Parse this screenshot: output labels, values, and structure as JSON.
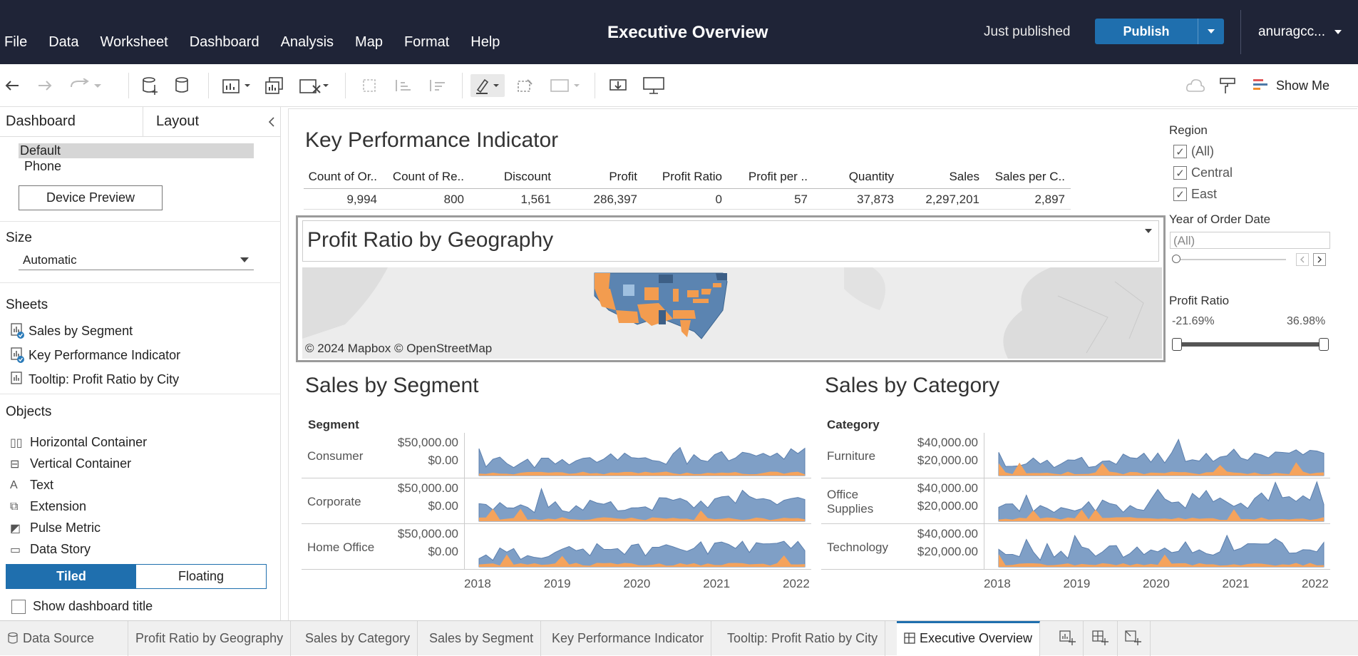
{
  "app": {
    "title": "Executive Overview",
    "menu": [
      "File",
      "Data",
      "Worksheet",
      "Dashboard",
      "Analysis",
      "Map",
      "Format",
      "Help"
    ],
    "status": "Just published",
    "publish_label": "Publish",
    "user": "anuragcc..."
  },
  "toolbar": {
    "show_me": "Show Me"
  },
  "left": {
    "tab_dashboard": "Dashboard",
    "tab_layout": "Layout",
    "devices": [
      "Default",
      "Phone"
    ],
    "device_preview": "Device Preview",
    "size_label": "Size",
    "size_value": "Automatic",
    "sheets_label": "Sheets",
    "sheets": [
      "Sales by Segment",
      "Key Performance Indicator",
      "Tooltip: Profit Ratio by City"
    ],
    "objects_label": "Objects",
    "objects": [
      "Horizontal Container",
      "Vertical Container",
      "Text",
      "Extension",
      "Pulse Metric",
      "Data Story"
    ],
    "tiled": "Tiled",
    "floating": "Floating",
    "show_title": "Show dashboard title"
  },
  "kpi": {
    "title": "Key Performance Indicator",
    "headers": [
      "Count of Or..",
      "Count of Re..",
      "Discount",
      "Profit",
      "Profit Ratio",
      "Profit per ..",
      "Quantity",
      "Sales",
      "Sales per C.."
    ],
    "values": [
      "9,994",
      "800",
      "1,561",
      "286,397",
      "0",
      "57",
      "37,873",
      "2,297,201",
      "2,897"
    ]
  },
  "geo": {
    "title": "Profit Ratio by Geography",
    "credit": "© 2024 Mapbox  © OpenStreetMap",
    "colors": {
      "positive": "#5b84b1",
      "negative": "#f39c4f",
      "land": "#d9d9d9"
    }
  },
  "segment": {
    "title": "Sales by Segment",
    "dim": "Segment",
    "rows": [
      {
        "label": "Consumer",
        "ticks": [
          "$50,000.00",
          "$0.00"
        ]
      },
      {
        "label": "Corporate",
        "ticks": [
          "$50,000.00",
          "$0.00"
        ]
      },
      {
        "label": "Home Office",
        "ticks": [
          "$50,000.00",
          "$0.00"
        ]
      }
    ],
    "years": [
      "2018",
      "2019",
      "2020",
      "2021",
      "2022"
    ]
  },
  "category": {
    "title": "Sales by Category",
    "dim": "Category",
    "rows": [
      {
        "label": "Furniture",
        "ticks": [
          "$40,000.00",
          "$20,000.00"
        ]
      },
      {
        "label": "Office\nSupplies",
        "ticks": [
          "$40,000.00",
          "$20,000.00"
        ]
      },
      {
        "label": "Technology",
        "ticks": [
          "$40,000.00",
          "$20,000.00"
        ]
      }
    ],
    "years": [
      "2018",
      "2019",
      "2020",
      "2021",
      "2022"
    ]
  },
  "filters": {
    "region_label": "Region",
    "region_items": [
      "(All)",
      "Central",
      "East"
    ],
    "year_label": "Year of Order Date",
    "year_value": "(All)",
    "profit_label": "Profit Ratio",
    "profit_min": "-21.69%",
    "profit_max": "36.98%"
  },
  "bottom_tabs": [
    "Data Source",
    "Profit Ratio by Geography",
    "Sales by Category",
    "Sales by Segment",
    "Key Performance Indicator",
    "Tooltip: Profit Ratio by City",
    "Executive Overview"
  ],
  "chart_colors": {
    "sales": "#7f9fc6",
    "profit": "#f5a35c"
  }
}
